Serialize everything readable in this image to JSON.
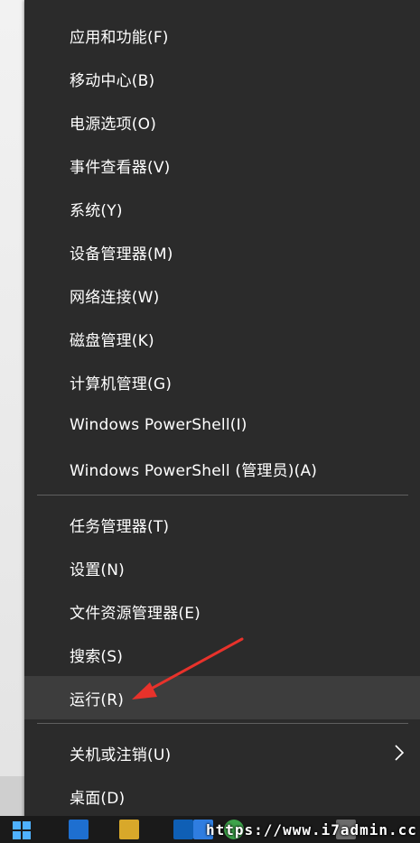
{
  "menu": {
    "items": [
      {
        "label": "应用和功能(F)"
      },
      {
        "label": "移动中心(B)"
      },
      {
        "label": "电源选项(O)"
      },
      {
        "label": "事件查看器(V)"
      },
      {
        "label": "系统(Y)"
      },
      {
        "label": "设备管理器(M)"
      },
      {
        "label": "网络连接(W)"
      },
      {
        "label": "磁盘管理(K)"
      },
      {
        "label": "计算机管理(G)"
      },
      {
        "label": "Windows PowerShell(I)"
      },
      {
        "label": "Windows PowerShell (管理员)(A)"
      },
      {
        "label": "任务管理器(T)"
      },
      {
        "label": "设置(N)"
      },
      {
        "label": "文件资源管理器(E)"
      },
      {
        "label": "搜索(S)"
      },
      {
        "label": "运行(R)",
        "highlighted": true
      },
      {
        "label": "关机或注销(U)",
        "submenu": true,
        "icon": "chevron-right-icon"
      },
      {
        "label": "桌面(D)"
      }
    ]
  },
  "annotation": {
    "color": "#e8322b",
    "icon": "red-arrow-pointer"
  },
  "taskbar": {
    "icons": [
      "start-icon",
      "edge-icon",
      "store-icon",
      "outlook-icon",
      "folder-icon",
      "chrome-icon",
      "app-icon"
    ],
    "watermark": "https://www.i7admin.cc"
  },
  "colors": {
    "menu_bg": "#2b2b2b",
    "hover_bg": "#3d3d3d",
    "separator": "#5f5f5f",
    "text": "#ffffff"
  }
}
